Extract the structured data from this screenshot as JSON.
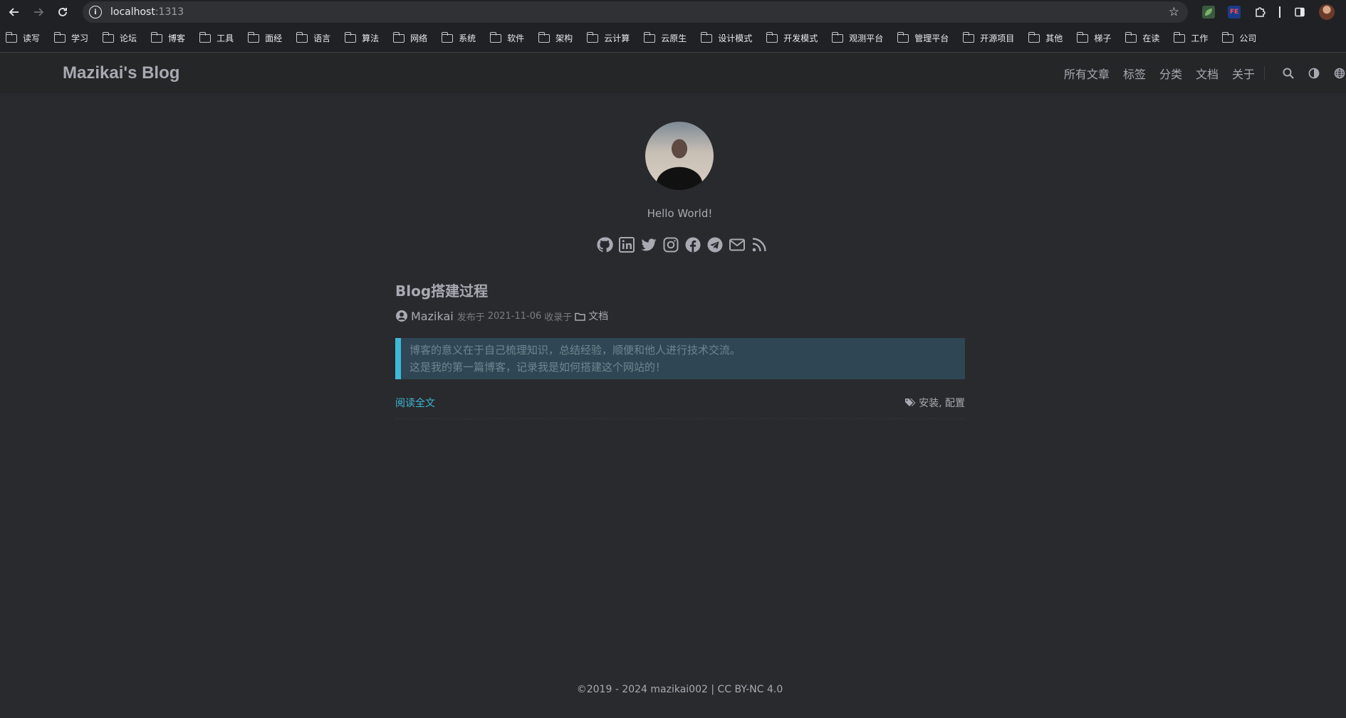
{
  "browser": {
    "url_host": "localhost",
    "url_port": ":1313",
    "bookmarks": [
      "读写",
      "学习",
      "论坛",
      "博客",
      "工具",
      "面经",
      "语言",
      "算法",
      "网络",
      "系统",
      "软件",
      "架构",
      "云计算",
      "云原生",
      "设计模式",
      "开发模式",
      "观测平台",
      "管理平台",
      "开源项目",
      "其他",
      "梯子",
      "在读",
      "工作",
      "公司"
    ],
    "extensions": [
      {
        "icon": "leaf-extension-icon",
        "color": "#4a7c59",
        "text": ""
      },
      {
        "icon": "fe-extension-icon",
        "color": "#d93025",
        "text": "FE"
      },
      {
        "icon": "puzzle-extension-icon",
        "color": "#202124",
        "text": ""
      }
    ]
  },
  "site": {
    "logo": "Mazikai's Blog",
    "menu": [
      "所有文章",
      "标签",
      "分类",
      "文档",
      "关于"
    ],
    "subtitle": "Hello World!",
    "socials": [
      "github-icon",
      "linkedin-icon",
      "twitter-icon",
      "instagram-icon",
      "facebook-icon",
      "telegram-icon",
      "email-icon",
      "rss-icon"
    ]
  },
  "post": {
    "title": "Blog搭建过程",
    "author": "Mazikai",
    "published_label": "发布于",
    "date": "2021-11-06",
    "collected_label": "收录于",
    "category": "文档",
    "summary_line1": "博客的意义在于自己梳理知识，总结经验，顺便和他人进行技术交流。",
    "summary_line2": "这是我的第一篇博客，记录我是如何搭建这个网站的！",
    "read_more": "阅读全文",
    "tags": "安装, 配置"
  },
  "footer": {
    "text": "2019 - 2024 mazikai002 | CC BY-NC 4.0"
  },
  "colors": {
    "accent": "#3fb8d8",
    "background": "#292a2d",
    "header": "#252627"
  }
}
